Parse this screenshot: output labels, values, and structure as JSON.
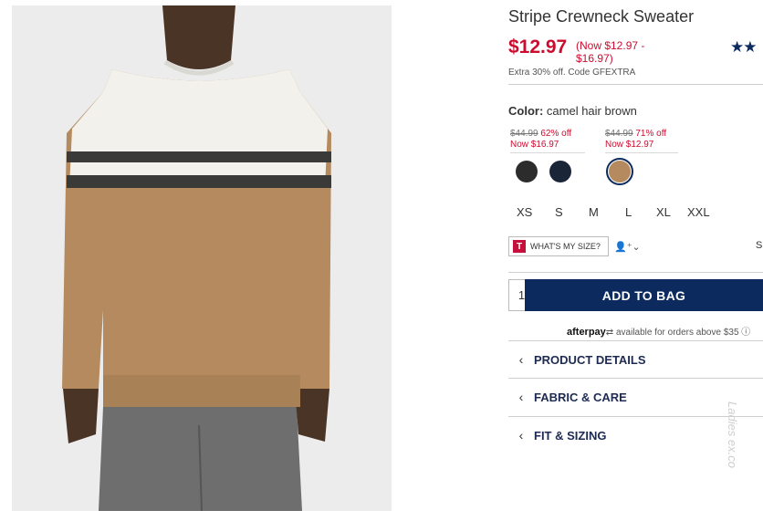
{
  "product": {
    "title": "Stripe Crewneck Sweater",
    "rating_stars": "★★",
    "price": "$12.97",
    "price_range": "(Now $12.97 - $16.97)",
    "promo": "Extra 30% off. Code GFEXTRA"
  },
  "color": {
    "label": "Color:",
    "value": "camel hair brown",
    "groups": [
      {
        "old": "$44.99",
        "pct": "62% off",
        "now": "Now $16.97"
      },
      {
        "old": "$44.99",
        "pct": "71% off",
        "now": "Now $12.97"
      }
    ],
    "swatches": [
      {
        "name": "black",
        "hex": "#2c2c2c"
      },
      {
        "name": "navy",
        "hex": "#1b2538"
      },
      {
        "name": "camel hair brown",
        "hex": "#b48a5e",
        "selected": true
      }
    ]
  },
  "sizes": [
    "XS",
    "S",
    "M",
    "L",
    "XL",
    "XXL"
  ],
  "fit": {
    "t_logo": "T",
    "whats_my_size": "WHAT'S MY SIZE?",
    "person_icon": "person-plus-icon",
    "cut_text": "S"
  },
  "cart": {
    "quantity": "1",
    "add_to_bag": "ADD TO BAG"
  },
  "afterpay": {
    "brand": "afterpay",
    "text": "available for orders above $35"
  },
  "accordions": [
    {
      "label": "PRODUCT DETAILS"
    },
    {
      "label": "FABRIC & CARE"
    },
    {
      "label": "FIT & SIZING"
    }
  ],
  "watermark": "Ladies ex.co"
}
